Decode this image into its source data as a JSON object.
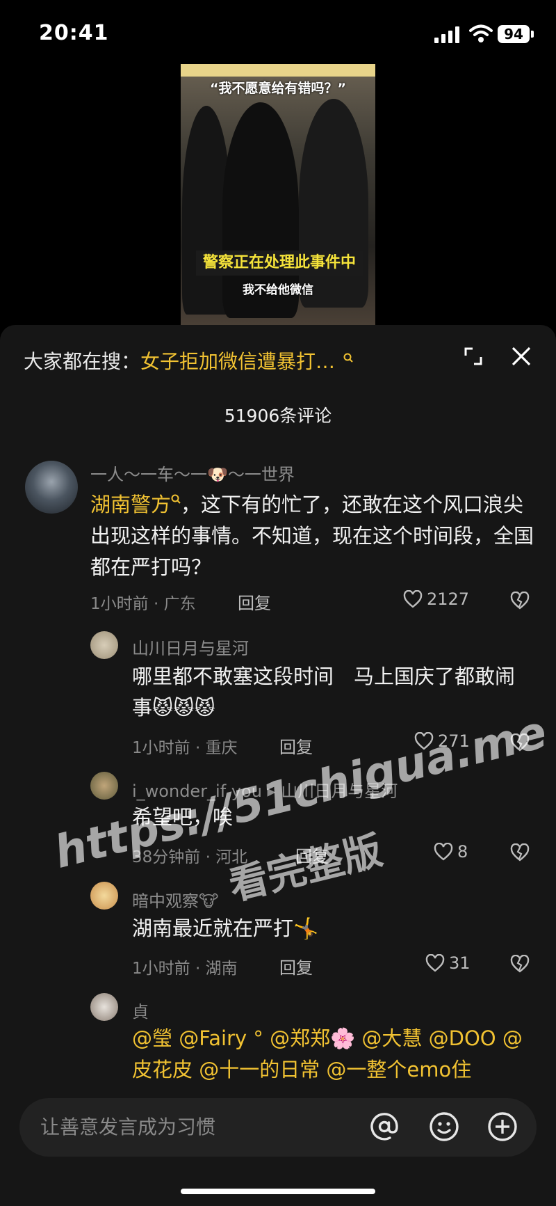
{
  "status_bar": {
    "time": "20:41",
    "battery": "94"
  },
  "video": {
    "title": "“我不愿意给有错吗？”",
    "caption": "警察正在处理此事件中",
    "subtitle": "我不给他微信"
  },
  "header": {
    "search_prefix": "大家都在搜：",
    "search_term": "女子拒加微信遭暴打…",
    "comment_count": "51906条评论"
  },
  "comments": [
    {
      "username": "一人～一车～一🐶～一世界",
      "mention": "湖南警方",
      "text": "，这下有的忙了，还敢在这个风口浪尖出现这样的事情。不知道，现在这个时间段，全国都在严打吗？",
      "meta": "1小时前 · 广东",
      "reply_label": "回复",
      "likes": "2127"
    },
    {
      "username": "山川日月与星河",
      "text": "哪里都不敢塞这段时间　马上国庆了都敢闹事😾😾😾",
      "meta": "1小时前 · 重庆",
      "reply_label": "回复",
      "likes": "271"
    },
    {
      "username": "i_wonder_if you ▸ 山川日月与星河",
      "text": "希望吧，唉",
      "meta": "38分钟前 · 河北",
      "reply_label": "回复",
      "likes": "8"
    },
    {
      "username": "暗中观察🐮",
      "text": "湖南最近就在严打🤸",
      "meta": "1小时前 · 湖南",
      "reply_label": "回复",
      "likes": "31"
    },
    {
      "username": "貞",
      "text": "@瑩 @Fairy ° @郑郑🌸 @大慧 @DOO @皮花皮 @十一的日常 @一整个emo住"
    }
  ],
  "watermark": {
    "line1": "https://51chigua.me",
    "line2": "看完整版"
  },
  "input": {
    "placeholder": "让善意发言成为习惯"
  },
  "icons": {
    "search": "search-icon",
    "expand": "expand-icon",
    "close": "close-icon",
    "like": "heart-icon",
    "dislike": "broken-heart-icon",
    "at": "at-icon",
    "emoji": "emoji-icon",
    "add": "plus-icon"
  },
  "colors": {
    "accent": "#f1c232",
    "sheet": "#161616",
    "background": "#000000"
  }
}
